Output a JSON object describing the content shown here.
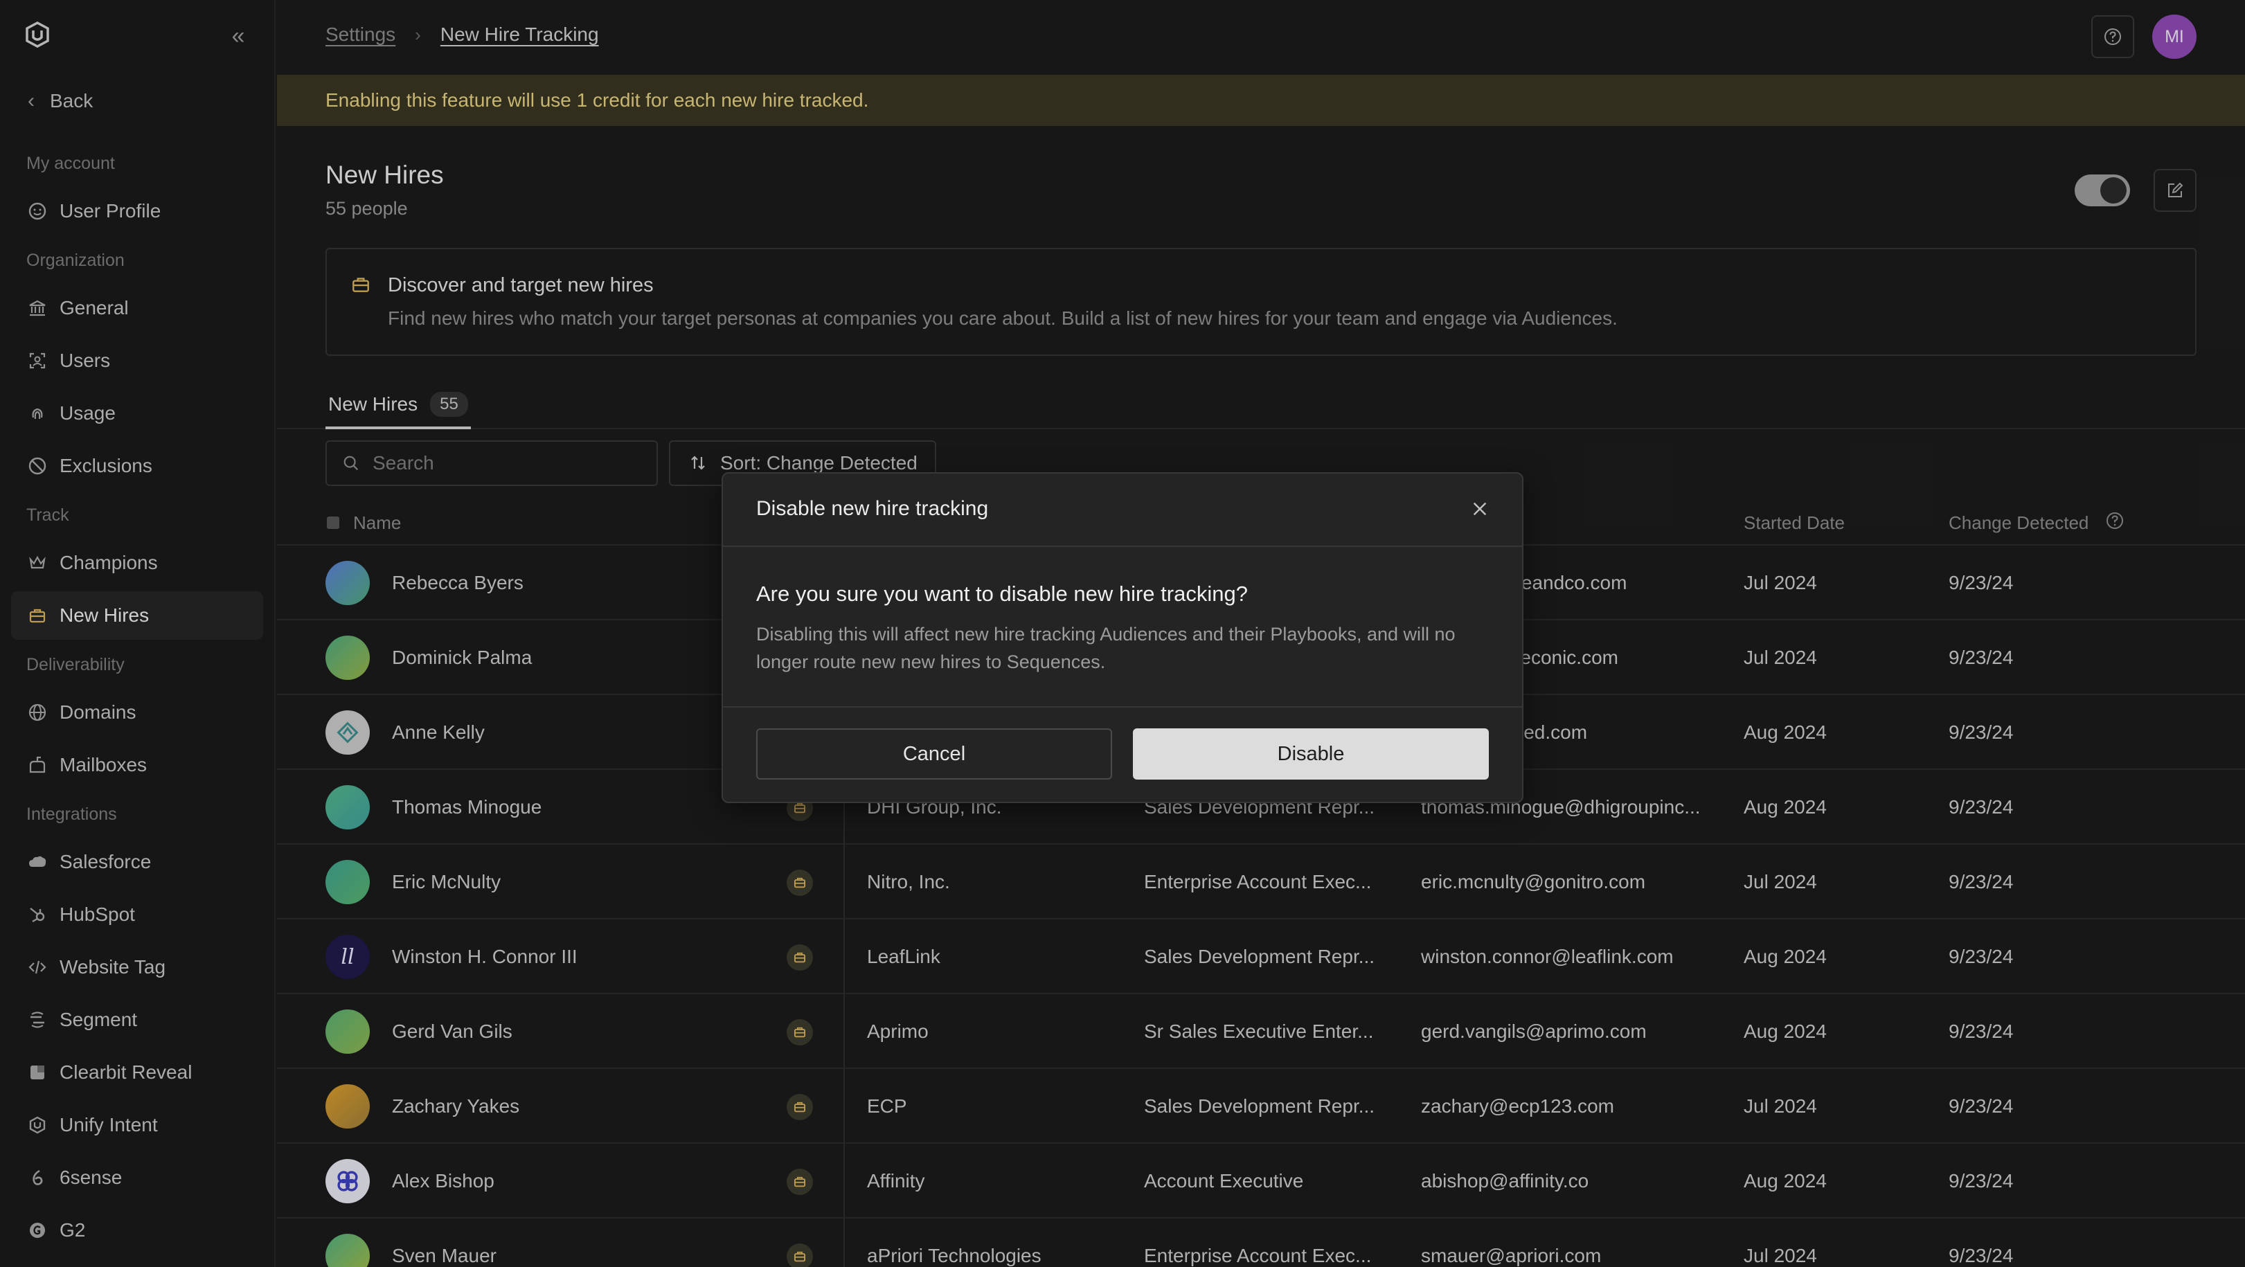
{
  "sidebar": {
    "back_label": "Back",
    "sections": {
      "my_account": "My account",
      "organization": "Organization",
      "track": "Track",
      "deliverability": "Deliverability",
      "integrations": "Integrations"
    },
    "items": {
      "user_profile": "User Profile",
      "general": "General",
      "users": "Users",
      "usage": "Usage",
      "exclusions": "Exclusions",
      "champions": "Champions",
      "new_hires": "New Hires",
      "domains": "Domains",
      "mailboxes": "Mailboxes",
      "salesforce": "Salesforce",
      "hubspot": "HubSpot",
      "website_tag": "Website Tag",
      "segment": "Segment",
      "clearbit_reveal": "Clearbit Reveal",
      "unify_intent": "Unify Intent",
      "sixsense": "6sense",
      "g2": "G2"
    }
  },
  "header": {
    "breadcrumb_settings": "Settings",
    "breadcrumb_current": "New Hire Tracking",
    "avatar_initials": "MI",
    "avatar_color": "#8d4ab3"
  },
  "banner": {
    "text": "Enabling this feature will use 1 credit for each new hire tracked."
  },
  "page": {
    "title": "New Hires",
    "subtitle": "55 people",
    "toggle_enabled": true
  },
  "info_card": {
    "title": "Discover and target new hires",
    "description": "Find new hires who match your target personas at companies you care about. Build a list of new hires for your team and engage via Audiences."
  },
  "tabs": [
    {
      "label": "New Hires",
      "count": "55"
    }
  ],
  "search": {
    "placeholder": "Search"
  },
  "sort": {
    "label": "Sort: Change Detected"
  },
  "table": {
    "columns": {
      "name": "Name",
      "started": "Started Date",
      "change": "Change Detected"
    },
    "rows": [
      {
        "name": "Rebecca Byers",
        "company": "",
        "title": "",
        "email": "rs@zoneandco.com",
        "started": "Jul 2024",
        "change": "9/23/24"
      },
      {
        "name": "Dominick Palma",
        "company": "",
        "title": "",
        "email": "blueconic.com",
        "started": "Jul 2024",
        "change": "9/23/24"
      },
      {
        "name": "Anne Kelly",
        "company": "",
        "title": "",
        "email": "ified.com",
        "started": "Aug 2024",
        "change": "9/23/24"
      },
      {
        "name": "Thomas Minogue",
        "company": "DHI Group, Inc.",
        "title": "Sales Development Repr...",
        "email": "thomas.minogue@dhigroupinc...",
        "started": "Aug 2024",
        "change": "9/23/24"
      },
      {
        "name": "Eric McNulty",
        "company": "Nitro, Inc.",
        "title": "Enterprise Account Exec...",
        "email": "eric.mcnulty@gonitro.com",
        "started": "Jul 2024",
        "change": "9/23/24"
      },
      {
        "name": "Winston H. Connor III",
        "company": "LeafLink",
        "title": "Sales Development Repr...",
        "email": "winston.connor@leaflink.com",
        "started": "Aug 2024",
        "change": "9/23/24"
      },
      {
        "name": "Gerd Van Gils",
        "company": "Aprimo",
        "title": "Sr Sales Executive Enter...",
        "email": "gerd.vangils@aprimo.com",
        "started": "Aug 2024",
        "change": "9/23/24"
      },
      {
        "name": "Zachary Yakes",
        "company": "ECP",
        "title": "Sales Development Repr...",
        "email": "zachary@ecp123.com",
        "started": "Jul 2024",
        "change": "9/23/24"
      },
      {
        "name": "Alex Bishop",
        "company": "Affinity",
        "title": "Account Executive",
        "email": "abishop@affinity.co",
        "started": "Aug 2024",
        "change": "9/23/24"
      },
      {
        "name": "Sven Mauer",
        "company": "aPriori Technologies",
        "title": "Enterprise Account Exec...",
        "email": "smauer@apriori.com",
        "started": "Jul 2024",
        "change": "9/23/24"
      }
    ]
  },
  "modal": {
    "title": "Disable new hire tracking",
    "question": "Are you sure you want to disable new hire tracking?",
    "description": "Disabling this will affect new hire tracking Audiences and their Playbooks, and will no longer route new new hires to Sequences.",
    "cancel_label": "Cancel",
    "confirm_label": "Disable"
  },
  "colors": {
    "banner_bg": "#3a3522",
    "banner_text": "#e3cf85",
    "accent_avatar": "#8d4ab3"
  }
}
